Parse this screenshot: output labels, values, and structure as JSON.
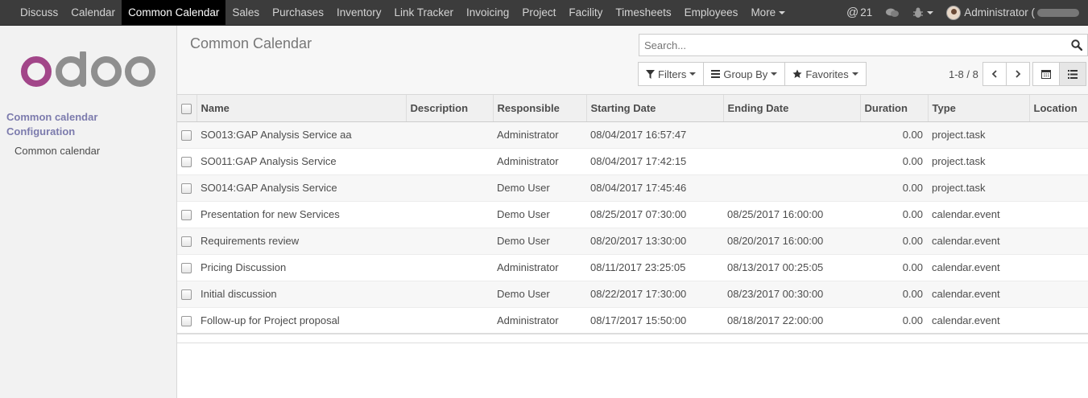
{
  "topbar": {
    "menu": [
      "Discuss",
      "Calendar",
      "Common Calendar",
      "Sales",
      "Purchases",
      "Inventory",
      "Link Tracker",
      "Invoicing",
      "Project",
      "Facility",
      "Timesheets",
      "Employees"
    ],
    "more_label": "More",
    "active_index": 2,
    "mentions_count": "21",
    "user_name": "Administrator ("
  },
  "sidebar": {
    "logo_alt": "odoo",
    "section_label": "Common calendar Configuration",
    "link_label": "Common calendar"
  },
  "control": {
    "title": "Common Calendar",
    "search_placeholder": "Search...",
    "filters_label": "Filters",
    "groupby_label": "Group By",
    "favorites_label": "Favorites",
    "pager_value": "1-8 / 8"
  },
  "table": {
    "columns": [
      "Name",
      "Description",
      "Responsible",
      "Starting Date",
      "Ending Date",
      "Duration",
      "Type",
      "Location"
    ],
    "rows": [
      {
        "name": "SO013:GAP Analysis Service aa",
        "description": "",
        "responsible": "Administrator",
        "start": "08/04/2017 16:57:47",
        "end": "",
        "duration": "0.00",
        "type": "project.task",
        "location": ""
      },
      {
        "name": "SO011:GAP Analysis Service",
        "description": "",
        "responsible": "Administrator",
        "start": "08/04/2017 17:42:15",
        "end": "",
        "duration": "0.00",
        "type": "project.task",
        "location": ""
      },
      {
        "name": "SO014:GAP Analysis Service",
        "description": "",
        "responsible": "Demo User",
        "start": "08/04/2017 17:45:46",
        "end": "",
        "duration": "0.00",
        "type": "project.task",
        "location": ""
      },
      {
        "name": "Presentation for new Services",
        "description": "",
        "responsible": "Demo User",
        "start": "08/25/2017 07:30:00",
        "end": "08/25/2017 16:00:00",
        "duration": "0.00",
        "type": "calendar.event",
        "location": ""
      },
      {
        "name": "Requirements review",
        "description": "",
        "responsible": "Demo User",
        "start": "08/20/2017 13:30:00",
        "end": "08/20/2017 16:00:00",
        "duration": "0.00",
        "type": "calendar.event",
        "location": ""
      },
      {
        "name": "Pricing Discussion",
        "description": "",
        "responsible": "Administrator",
        "start": "08/11/2017 23:25:05",
        "end": "08/13/2017 00:25:05",
        "duration": "0.00",
        "type": "calendar.event",
        "location": ""
      },
      {
        "name": "Initial discussion",
        "description": "",
        "responsible": "Demo User",
        "start": "08/22/2017 17:30:00",
        "end": "08/23/2017 00:30:00",
        "duration": "0.00",
        "type": "calendar.event",
        "location": ""
      },
      {
        "name": "Follow-up for Project proposal",
        "description": "",
        "responsible": "Administrator",
        "start": "08/17/2017 15:50:00",
        "end": "08/18/2017 22:00:00",
        "duration": "0.00",
        "type": "calendar.event",
        "location": ""
      }
    ]
  },
  "colors": {
    "topbar_bg": "#3c3c3c",
    "brand_purple": "#a24689",
    "brand_gray": "#8f8f8f",
    "section_color": "#7c7bad"
  },
  "icons": {
    "mentions": "at-icon",
    "chat": "chat-bubbles-icon",
    "debug": "bug-icon",
    "search": "search-icon",
    "filter": "filter-icon",
    "groupby": "list-bars-icon",
    "favorites": "star-icon",
    "prev": "chevron-left-icon",
    "next": "chevron-right-icon",
    "calendar_view": "calendar-icon",
    "list_view": "list-icon"
  }
}
